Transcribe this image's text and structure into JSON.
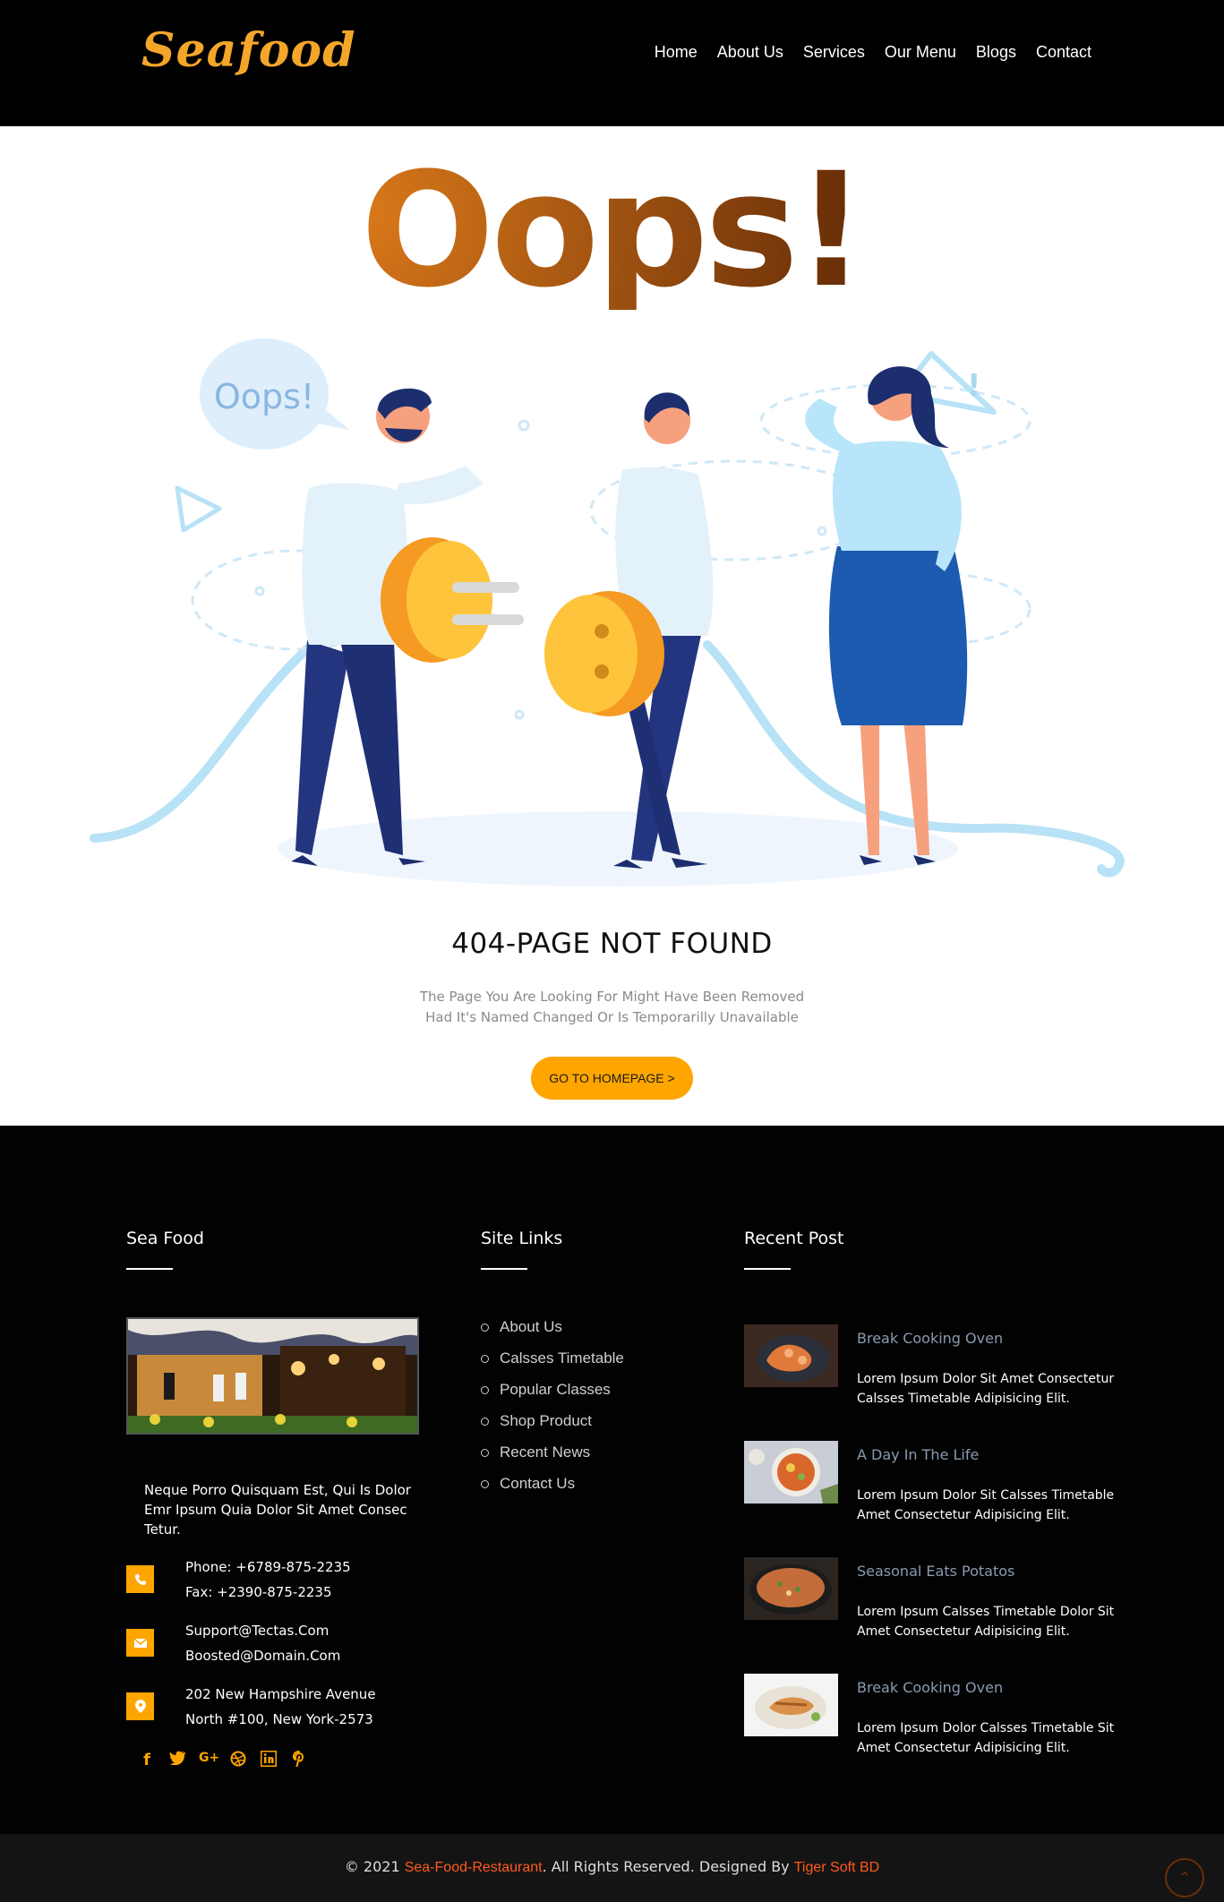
{
  "brand": {
    "logo": "Seafood"
  },
  "nav": {
    "items": [
      "Home",
      "About Us",
      "Services",
      "Our Menu",
      "Blogs",
      "Contact"
    ]
  },
  "hero": {
    "oops": "Oops!",
    "bubble": "Oops!"
  },
  "error": {
    "title": "404-PAGE NOT FOUND",
    "line1": "The Page You Are Looking For Might Have Been Removed",
    "line2": "Had It's Named Changed Or Is Temporarilly Unavailable",
    "button": "GO TO HOMEPAGE >"
  },
  "footer": {
    "col1": {
      "title": "Sea Food",
      "about": "Neque Porro Quisquam Est, Qui Is Dolor Emr Ipsum Quia Dolor Sit Amet Consec Tetur.",
      "phone": "Phone: +6789-875-2235",
      "fax": "Fax: +2390-875-2235",
      "email1": "Support@Tectas.Com",
      "email2": "Boosted@Domain.Com",
      "addr1": "202 New Hampshire Avenue",
      "addr2": "North #100, New York-2573",
      "socials": [
        "facebook-icon",
        "twitter-icon",
        "google-plus-icon",
        "dribbble-icon",
        "linkedin-icon",
        "pinterest-icon"
      ]
    },
    "col2": {
      "title": "Site Links",
      "links": [
        "About Us",
        "Calsses Timetable",
        "Popular Classes",
        "Shop Product",
        "Recent News",
        "Contact Us"
      ]
    },
    "col3": {
      "title": "Recent Post",
      "posts": [
        {
          "title": "Break Cooking Oven",
          "text": "Lorem Ipsum Dolor Sit Amet Consectetur Calsses Timetable Adipisicing Elit."
        },
        {
          "title": "A Day In The Life",
          "text": "Lorem Ipsum Dolor Sit Calsses Timetable Amet Consectetur Adipisicing Elit."
        },
        {
          "title": "Seasonal Eats Potatos",
          "text": "Lorem Ipsum Calsses Timetable Dolor Sit Amet Consectetur Adipisicing Elit."
        },
        {
          "title": "Break Cooking Oven",
          "text": "Lorem Ipsum Dolor Calsses Timetable Sit Amet Consectetur Adipisicing Elit."
        }
      ]
    }
  },
  "copyright": {
    "prefix": "© 2021 ",
    "site": "Sea-Food-Restaurant",
    "middle": ". All Rights Reserved. Designed By ",
    "designer": "Tiger Soft BD"
  },
  "colors": {
    "accent": "#ffa500",
    "header_bg": "#000000",
    "link_highlight": "#ff5a1f"
  }
}
